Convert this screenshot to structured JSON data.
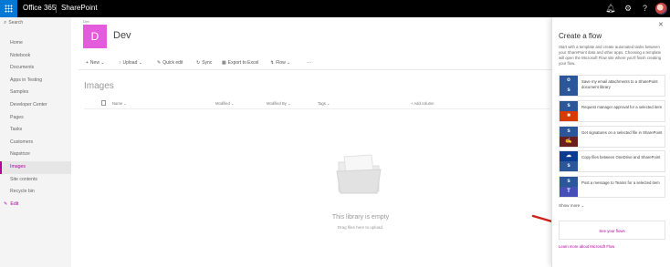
{
  "suitebar": {
    "brand": "Office 365",
    "app": "SharePoint",
    "icons": [
      "waffle-icon",
      "bell-icon",
      "gear-icon",
      "help-icon",
      "avatar"
    ]
  },
  "leftnav": {
    "search_placeholder": "Search",
    "items": [
      {
        "label": "Home"
      },
      {
        "label": "Notebook"
      },
      {
        "label": "Documents"
      },
      {
        "label": "Apps in Testing"
      },
      {
        "label": "Samples"
      },
      {
        "label": "Developer Center"
      },
      {
        "label": "Pages"
      },
      {
        "label": "Tasks"
      },
      {
        "label": "Customers"
      },
      {
        "label": "Napstrize"
      },
      {
        "label": "Images",
        "active": true
      },
      {
        "label": "Site contents"
      },
      {
        "label": "Recycle bin"
      }
    ],
    "edit_label": "Edit"
  },
  "site": {
    "small_label": "Dev",
    "logo_letter": "D",
    "title": "Dev",
    "logo_color": "#e45bdb"
  },
  "commandbar": {
    "new": "New",
    "upload": "Upload",
    "quick_edit": "Quick edit",
    "sync": "Sync",
    "export": "Export to Excel",
    "flow": "Flow",
    "more": "···"
  },
  "library": {
    "title": "Images",
    "columns": [
      "Name",
      "Modified",
      "Modified By",
      "Tags",
      "+ Add column"
    ],
    "empty_title": "This library is empty",
    "empty_sub": "Drag files here to upload."
  },
  "panel": {
    "title": "Create a flow",
    "description": "Start with a template and create automated tasks between your SharePoint data and other apps. Choosing a template will open the Microsoft Flow site where you'll finish creating your flow.",
    "flows": [
      {
        "text": "Save my email attachments to a SharePoint document library",
        "top_color": "#2b579a",
        "bottom_color": "#2b579a"
      },
      {
        "text": "Request manager approval for a selected item",
        "top_color": "#2b579a",
        "bottom_color": "#d83b01"
      },
      {
        "text": "Get signatures on a selected file in SharePoint",
        "top_color": "#2b579a",
        "bottom_color": "#6b1e1e"
      },
      {
        "text": "Copy files between OneDrive and SharePoint",
        "top_color": "#0a3d91",
        "bottom_color": "#2b579a"
      },
      {
        "text": "Post a message to Teams for a selected item",
        "top_color": "#2b579a",
        "bottom_color": "#464eb8"
      }
    ],
    "show_more": "Show more",
    "see_flows": "See your flows",
    "learn_more": "Learn more about Microsoft Flow",
    "accent": "#b4009e"
  }
}
